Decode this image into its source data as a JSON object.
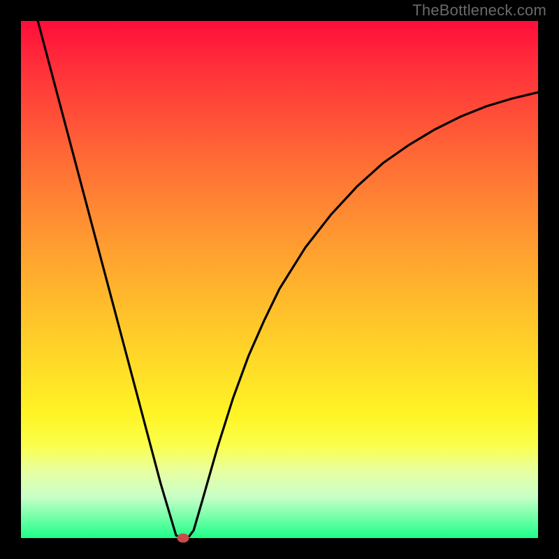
{
  "attribution": "TheBottleneck.com",
  "chart_data": {
    "type": "line",
    "title": "",
    "xlabel": "",
    "ylabel": "",
    "xlim": [
      0,
      100
    ],
    "ylim": [
      0,
      100
    ],
    "grid": false,
    "notes": "Bottleneck curve against vertical color gradient (red high → green low). Minimum point marked with red dot.",
    "x": [
      3,
      6,
      9,
      12,
      15,
      18,
      21,
      24,
      27,
      30,
      31.3,
      32.5,
      33.4,
      35,
      38,
      41,
      44,
      47,
      50,
      55,
      60,
      65,
      70,
      75,
      80,
      85,
      90,
      95,
      100
    ],
    "y": [
      101,
      89.7,
      78.4,
      67.1,
      55.8,
      44.5,
      33.2,
      21.9,
      10.6,
      0.5,
      0,
      0.3,
      1.5,
      7,
      17.5,
      27,
      35.2,
      42,
      48.2,
      56.2,
      62.6,
      68,
      72.5,
      76,
      79,
      81.5,
      83.5,
      85,
      86.2
    ],
    "min_point": {
      "x": 31.3,
      "y": 0
    }
  },
  "colors": {
    "curve": "#000000",
    "marker": "#c94a4a",
    "background_frame": "#000000"
  }
}
